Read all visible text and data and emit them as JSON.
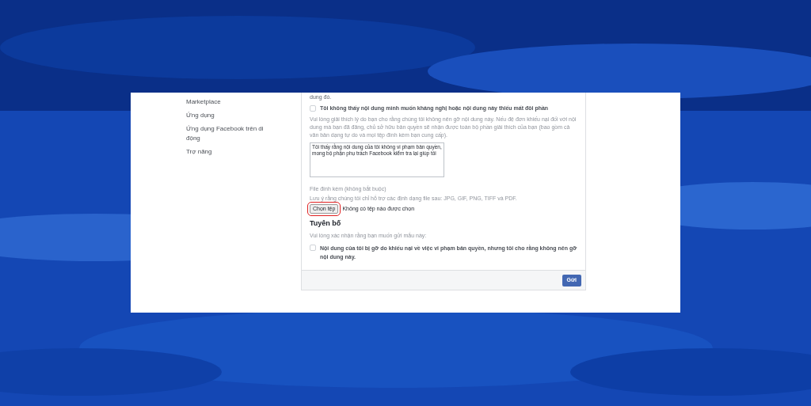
{
  "sidebar": {
    "items": [
      "Marketplace",
      "Ứng dụng",
      "Ứng dụng Facebook trên di động",
      "Trợ năng"
    ]
  },
  "form": {
    "cut_text": "dung đó.",
    "missing_content_checkbox": {
      "label": "Tôi không thấy nội dung mình muốn kháng nghị hoặc nội dung này thiếu mất đôi phần",
      "checked": false
    },
    "explain_hint": "Vui lòng giải thích lý do bạn cho rằng chúng tôi không nên gỡ nội dung này. Nếu đệ đơn khiếu nại đối với nội dung mà bạn đã đăng, chủ sở hữu bản quyền sẽ nhận được toàn bộ phần giải thích của bạn (bao gồm cả văn bản dạng tự do và mọi tệp đính kèm bạn cung cấp).",
    "explanation": "Tôi thấy rằng nội dung của tôi không vi phạm bản quyền, mong bộ phận phụ trách Facebook kiểm tra lại giúp tôi",
    "attachment_label": "File đính kèm (không bắt buộc)",
    "attachment_hint": "Lưu ý rằng chúng tôi chỉ hỗ trợ các định dạng file sau: JPG, GIF, PNG, TIFF và PDF.",
    "choose_file_button": "Chọn tệp",
    "file_status": "Không có tệp nào được chọn",
    "declaration_title": "Tuyên bố",
    "declaration_hint": "Vui lòng xác nhận rằng bạn muốn gửi mẫu này:",
    "declaration_checkbox": {
      "label": "Nội dung của tôi bị gỡ do khiếu nại về việc vi phạm bản quyền, nhưng tôi cho rằng không nên gỡ nội dung này.",
      "checked": false
    },
    "submit_button": "Gửi"
  }
}
